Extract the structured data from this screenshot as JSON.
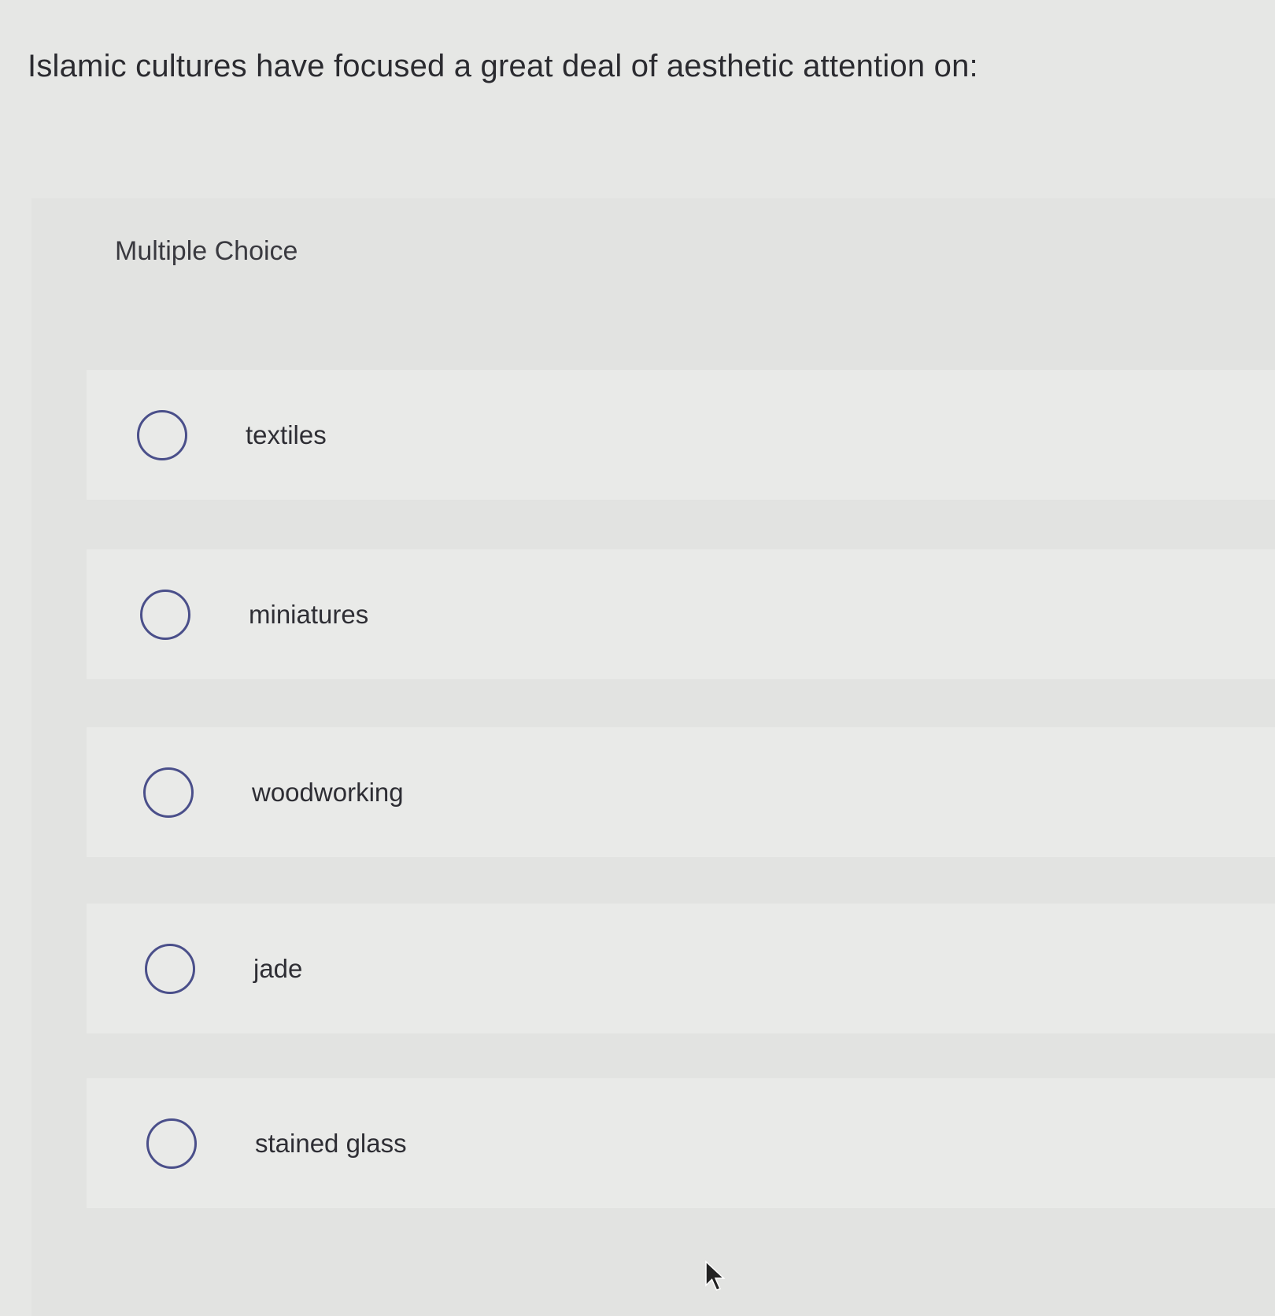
{
  "question": {
    "text": "Islamic cultures have focused a great deal of aesthetic attention on:"
  },
  "question_type": "Multiple Choice",
  "options": [
    {
      "label": "textiles",
      "selected": false
    },
    {
      "label": "miniatures",
      "selected": false
    },
    {
      "label": "woodworking",
      "selected": false
    },
    {
      "label": "jade",
      "selected": false
    },
    {
      "label": "stained glass",
      "selected": false
    }
  ],
  "colors": {
    "radio_border": "#4a4f8a",
    "background": "#e6e7e5"
  }
}
